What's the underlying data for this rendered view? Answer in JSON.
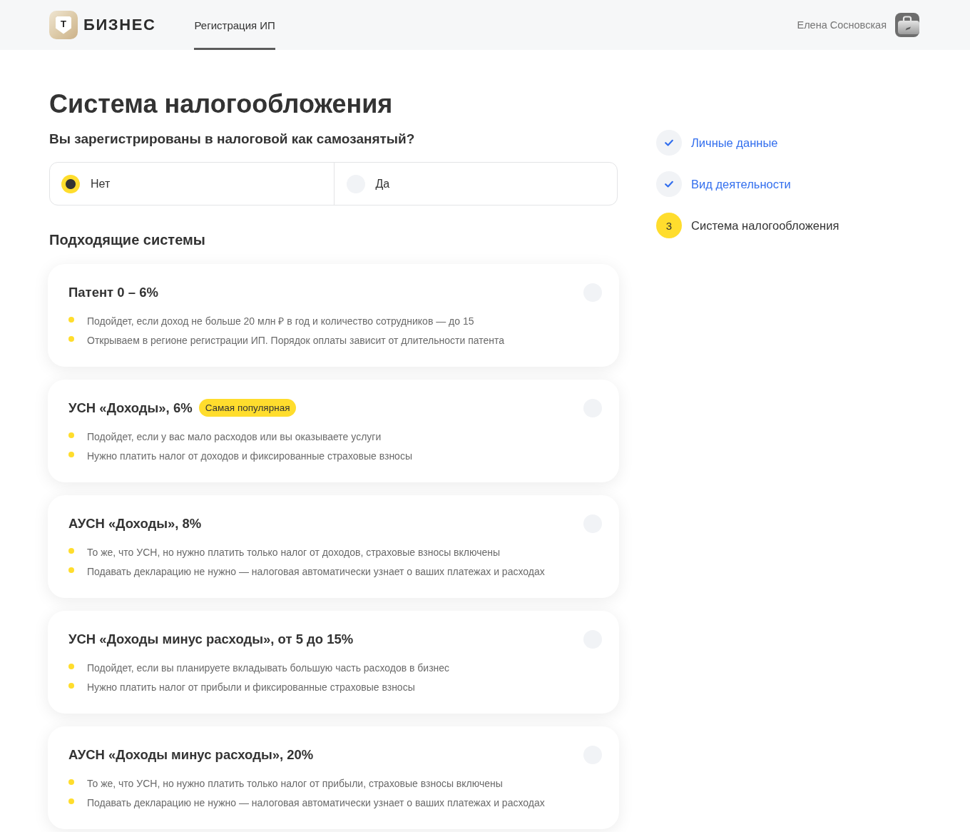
{
  "header": {
    "logo_mark": "Т",
    "logo_text": "БИЗНЕС",
    "nav": [
      {
        "label": "Регистрация ИП",
        "selected": true
      }
    ],
    "user_name": "Елена Сосновская"
  },
  "page": {
    "title": "Система налогообложения"
  },
  "question": {
    "label": "Вы зарегистрированы в налоговой как самозанятый?",
    "options": [
      {
        "label": "Нет",
        "selected": true
      },
      {
        "label": "Да",
        "selected": false
      }
    ]
  },
  "systems": {
    "heading": "Подходящие системы",
    "cards": [
      {
        "title": "Патент 0 – 6%",
        "selected": false,
        "bullets": [
          "Подойдет, если доход не больше 20 млн ₽ в год и количество сотрудников — до 15",
          "Открываем в регионе регистрации ИП. Порядок оплаты зависит от длительности патента"
        ]
      },
      {
        "title": "УСН «Доходы», 6%",
        "badge": "Самая популярная",
        "selected": false,
        "bullets": [
          "Подойдет, если у вас мало расходов или вы оказываете услуги",
          "Нужно платить налог от доходов и фиксированные страховые взносы"
        ]
      },
      {
        "title": "АУСН «Доходы», 8%",
        "selected": false,
        "bullets": [
          "То же, что УСН, но нужно платить только налог от доходов, страховые взносы включены",
          "Подавать декларацию не нужно — налоговая автоматически узнает о ваших платежах и расходах"
        ]
      },
      {
        "title": "УСН «Доходы минус расходы», от 5 до 15%",
        "selected": false,
        "bullets": [
          "Подойдет, если вы планируете вкладывать большую часть расходов в бизнес",
          "Нужно платить налог от прибыли и фиксированные страховые взносы"
        ]
      },
      {
        "title": "АУСН «Доходы минус расходы», 20%",
        "selected": false,
        "bullets": [
          "То же, что УСН, но нужно платить только налог от прибыли, страховые взносы включены",
          "Подавать декларацию не нужно — налоговая автоматически узнает о ваших платежах и расходах"
        ]
      }
    ]
  },
  "steps": [
    {
      "label": "Личные данные",
      "completed": true,
      "selected": false
    },
    {
      "label": "Вид деятельности",
      "completed": true,
      "selected": false
    },
    {
      "label": "Система налогообложения",
      "number": "3",
      "completed": false,
      "selected": true
    }
  ]
}
